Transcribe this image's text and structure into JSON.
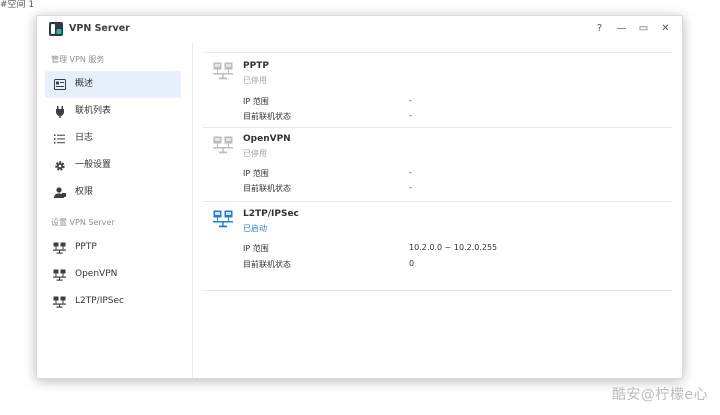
{
  "desktop_label": "#空间 1",
  "window": {
    "title": "VPN Server"
  },
  "controls": {
    "help": "?",
    "minimize": "—",
    "maximize": "▭",
    "close": "✕"
  },
  "sidebar": {
    "manage_header": "管理 VPN 服务",
    "manage_items": [
      {
        "label": "概述",
        "icon": "overview-icon",
        "active": true
      },
      {
        "label": "联机列表",
        "icon": "plug-icon"
      },
      {
        "label": "日志",
        "icon": "list-icon"
      },
      {
        "label": "一般设置",
        "icon": "gear-icon"
      },
      {
        "label": "权限",
        "icon": "user-icon"
      }
    ],
    "setup_header": "设置 VPN Server",
    "setup_items": [
      {
        "label": "PPTP",
        "icon": "network-icon"
      },
      {
        "label": "OpenVPN",
        "icon": "network-icon"
      },
      {
        "label": "L2TP/IPSec",
        "icon": "network-icon"
      }
    ]
  },
  "servers": [
    {
      "name": "PPTP",
      "status": "已停用",
      "enabled": false,
      "rows": [
        {
          "label": "IP 范围",
          "value": "-"
        },
        {
          "label": "目前联机状态",
          "value": "-"
        }
      ]
    },
    {
      "name": "OpenVPN",
      "status": "已停用",
      "enabled": false,
      "rows": [
        {
          "label": "IP 范围",
          "value": "-"
        },
        {
          "label": "目前联机状态",
          "value": "-"
        }
      ]
    },
    {
      "name": "L2TP/IPSec",
      "status": "已启动",
      "enabled": true,
      "rows": [
        {
          "label": "IP 范围",
          "value": "10.2.0.0 ~ 10.2.0.255"
        },
        {
          "label": "目前联机状态",
          "value": "0"
        }
      ]
    }
  ],
  "watermark": "酷安@柠檬e心",
  "colors": {
    "accent": "#2a82d6",
    "active_bg": "#e6f0fb",
    "disabled_icon": "#b9bdc2"
  }
}
